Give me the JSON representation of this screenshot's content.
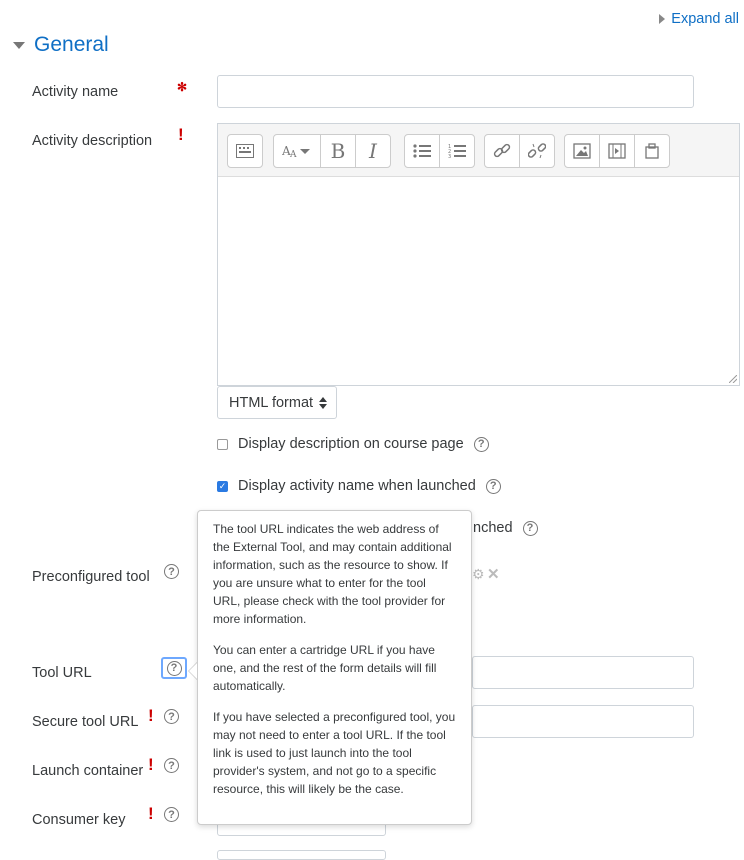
{
  "header": {
    "expand_all": "Expand all",
    "section_title": "General"
  },
  "fields": {
    "activity_name": {
      "label": "Activity name",
      "value": "",
      "required_icon": "required-asterisk-icon"
    },
    "activity_description": {
      "label": "Activity description"
    },
    "preconfigured_tool": {
      "label": "Preconfigured tool"
    },
    "tool_url": {
      "label": "Tool URL",
      "value": ""
    },
    "secure_tool_url": {
      "label": "Secure tool URL",
      "value": ""
    },
    "launch_container": {
      "label": "Launch container"
    },
    "consumer_key": {
      "label": "Consumer key",
      "value": ""
    }
  },
  "editor": {
    "toolbar_icons": [
      "toolbar-toggle-icon",
      "font-size-icon",
      "bold-icon",
      "italic-icon",
      "unordered-list-icon",
      "ordered-list-icon",
      "link-icon",
      "unlink-icon",
      "image-icon",
      "media-icon",
      "manage-files-icon"
    ],
    "bold_glyph": "B",
    "italic_glyph": "I",
    "content": ""
  },
  "format_select": {
    "value": "HTML format"
  },
  "checkboxes": {
    "display_description": {
      "label": "Display description on course page",
      "checked": false
    },
    "display_activity_name": {
      "label": "Display activity name when launched",
      "checked": true
    },
    "display_third_suffix": "nched"
  },
  "popover": {
    "p1": "The tool URL indicates the web address of the External Tool, and may contain additional information, such as the resource to show. If you are unsure what to enter for the tool URL, please check with the tool provider for more information.",
    "p2": "You can enter a cartridge URL if you have one, and the rest of the form details will fill automatically.",
    "p3": "If you have selected a preconfigured tool, you may not need to enter a tool URL. If the tool link is used to just launch into the tool provider's system, and not go to a specific resource, this will likely be the case."
  },
  "colors": {
    "link": "#0f6fc5",
    "required": "#cc0000",
    "checkbox_on": "#2a7ae2"
  }
}
